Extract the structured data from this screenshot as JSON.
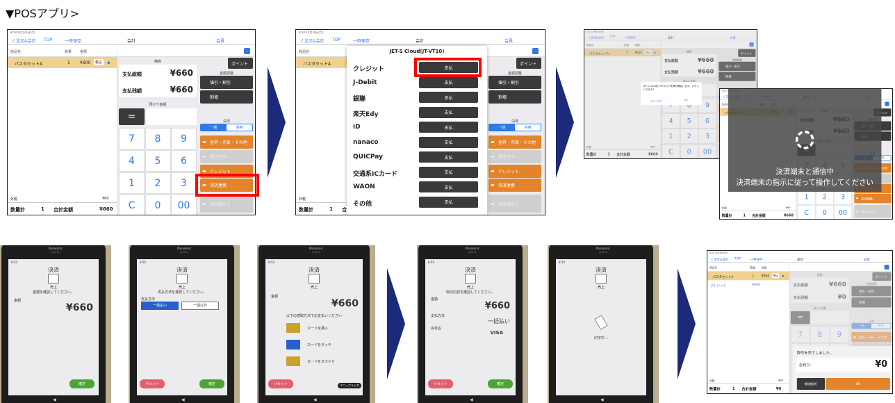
{
  "title": "▼POSアプリ>",
  "colors": {
    "accent_orange": "#e3832a",
    "accent_blue": "#2f7ae5",
    "highlight_red": "#ff0000",
    "arrow_navy": "#1c2a7a",
    "item_row": "#f0d190"
  },
  "pos": {
    "status": "8:50  10月26日(月)",
    "nav": {
      "back": "く注文&会計",
      "top": "TOP",
      "hold": "一時保存",
      "title": "会計",
      "member": "会員"
    },
    "columns": {
      "name": "商品名",
      "qty": "数量",
      "amount": "金額"
    },
    "item": {
      "name": "パスタセットA",
      "qty": "1",
      "price": "¥600",
      "tag": "税込"
    },
    "settle_label": "精算",
    "total_label": "支払総額",
    "remaining_label": "支払残額",
    "point_button": "ポイント",
    "adjust_label": "金額調整",
    "discount_button": "値引・割引",
    "surcharge_button": "割増",
    "deposit_label": "預かり金額",
    "equals_button": "=",
    "keys": [
      "7",
      "8",
      "9",
      "4",
      "5",
      "6",
      "1",
      "2",
      "3",
      "C",
      "0",
      "00"
    ],
    "payment_label": "決済",
    "segment": [
      "一括",
      "併用"
    ],
    "pay_buttons": [
      {
        "label": "金券・売掛・その他",
        "state": "active"
      },
      {
        "label": "電子マネー",
        "state": "disabled"
      },
      {
        "label": "クレジット",
        "state": "active"
      },
      {
        "label": "決済連携",
        "state": "active"
      },
      {
        "label": "現金預かり",
        "state": "disabled"
      }
    ],
    "tax_label": "外税",
    "tax_value": "¥60",
    "qty_total_label": "数量計",
    "qty_total": "1",
    "grand_total_label": "合計金額"
  },
  "screens": {
    "s1": {
      "total": "¥660",
      "remaining": "¥660",
      "grand_total": "¥660"
    },
    "s2": {
      "total": "¥660",
      "remaining": "¥660",
      "grand_total": "¥660",
      "modal": {
        "title": "JET-S Cloud(JT-VT10)",
        "pay_label": "支払",
        "methods": [
          "クレジット",
          "J-Debit",
          "銀聯",
          "楽天Edy",
          "iD",
          "nanaco",
          "QUICPay",
          "交通系ICカード",
          "WAON",
          "その他"
        ]
      }
    },
    "s3a": {
      "total": "¥660",
      "remaining": "¥660",
      "grand_total": "¥660",
      "dialog": {
        "message": "JET-S Cloud(JT-VT10)で決済を開始します。よろしいですか？",
        "cancel": "キャンセル",
        "ok": "OK"
      }
    },
    "s3b": {
      "total": "¥660",
      "remaining": "¥660",
      "grand_total": "¥660",
      "overlay": {
        "line1": "決済端末と通信中",
        "line2": "決済端末の指示に従って操作してください"
      }
    },
    "s5": {
      "total": "¥660",
      "remaining": "¥0",
      "grand_total": "¥0",
      "paid_line": {
        "method": "クレジット",
        "amount": "¥660"
      },
      "complete": {
        "message": "取引を完了しました。",
        "change_label": "お釣り：",
        "change": "¥0",
        "receipt_button": "領収書発行",
        "ok_button": "OK"
      }
    }
  },
  "terminal": {
    "brand": "Panasonic",
    "model": "JT-VT10",
    "time": "8:50",
    "screen_title": "決済",
    "sale": "売上",
    "t1": {
      "prompt": "金額を確認してください。",
      "amount_label": "金額",
      "amount": "¥660",
      "confirm": "確定"
    },
    "t2": {
      "prompt": "支払方法を選択してください。",
      "method_label": "支払方法",
      "option_lump": "一括払い",
      "option_other": "一括以外",
      "reset": "リセット",
      "confirm": "確定"
    },
    "t3": {
      "amount_label": "金額",
      "amount": "¥660",
      "prompt": "以下の読取方法でお支払いください",
      "insert": "カードを挿入",
      "touch": "カードをタッチ",
      "swipe": "カードをスライド",
      "reset": "リセット",
      "manual": "マニュアル入力"
    },
    "t4": {
      "prompt": "取引内容を確認してください。",
      "amount_label": "金額",
      "amount": "¥660",
      "method_label": "支払方法",
      "method": "一括払い",
      "company_label": "会社名",
      "company": "VISA",
      "reset": "リセット",
      "confirm": "確定"
    },
    "t5": {
      "printing": "印字中…"
    }
  }
}
